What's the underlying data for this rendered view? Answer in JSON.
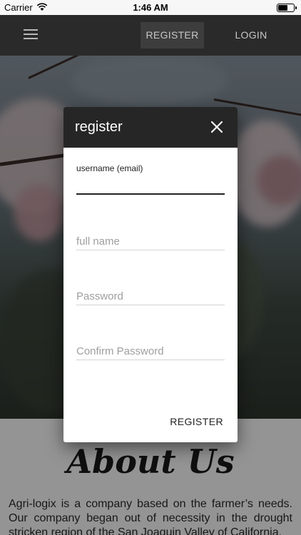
{
  "status_bar": {
    "carrier": "Carrier",
    "time": "1:46 AM",
    "battery_level": 0.6
  },
  "app_bar": {
    "register_label": "REGISTER",
    "login_label": "LOGIN"
  },
  "modal": {
    "title": "register",
    "fields": {
      "username_label": "username (email)",
      "username_value": "",
      "full_name_placeholder": "full name",
      "password_placeholder": "Password",
      "confirm_password_placeholder": "Confirm Password"
    },
    "submit_label": "REGISTER"
  },
  "about": {
    "title": "About Us",
    "text": "Agri-logix is a company based on the farmer’s needs. Our company began out of necessity in the drought stricken region of the San Joaquin Valley of California."
  },
  "colors": {
    "app_bar": "#2a2a2a",
    "modal_header": "#262626",
    "overlay": "rgba(0,0,0,0.42)"
  }
}
